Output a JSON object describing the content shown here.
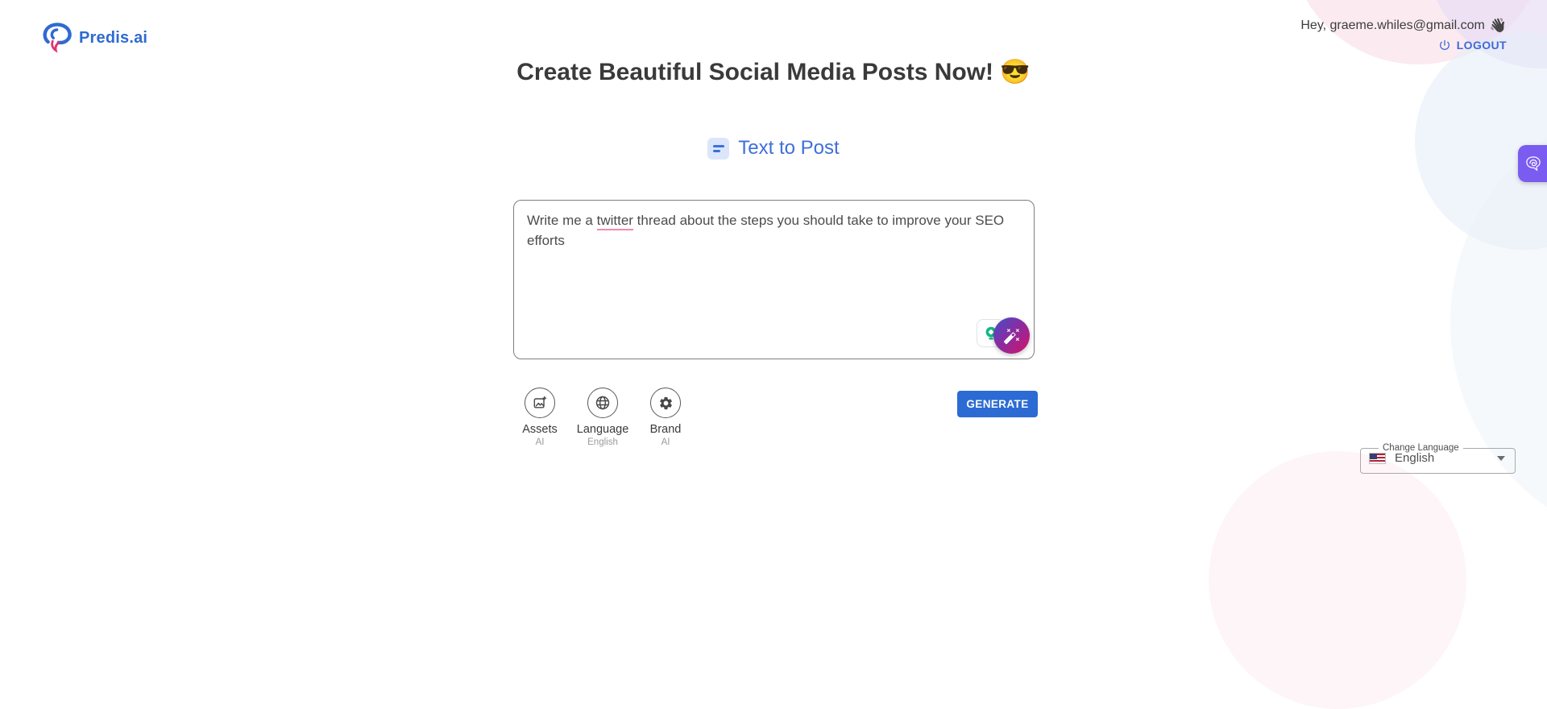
{
  "header": {
    "brand": "Predis.ai",
    "greeting": "Hey, graeme.whiles@gmail.com",
    "greeting_emoji": "👋",
    "logout": "LOGOUT"
  },
  "main": {
    "title": "Create Beautiful Social Media Posts Now!",
    "title_emoji": "😎",
    "tab": "Text to Post",
    "prompt": {
      "value_before": "Write me a ",
      "value_misspelled": "twitter",
      "value_after": " thread about the steps you should take to improve your SEO efforts"
    },
    "options": [
      {
        "label": "Assets",
        "sublabel": "AI",
        "icon": "add-image-icon"
      },
      {
        "label": "Language",
        "sublabel": "English",
        "icon": "globe-icon"
      },
      {
        "label": "Brand",
        "sublabel": "AI",
        "icon": "gear-icon"
      }
    ],
    "generate": "GENERATE"
  },
  "footer": {
    "change_language_label": "Change Language",
    "change_language_value": "English"
  },
  "colors": {
    "accent_blue": "#2c6bd3",
    "link_blue": "#3e6fd9",
    "tab_chip_bg": "#dbe6fb",
    "spellcheck_underline": "#f48bab",
    "wand_gradient_start": "#4150c8",
    "wand_gradient_end": "#d41268",
    "idea_green": "#0fb884",
    "fab_purple": "#7a5cf0",
    "text_dark": "#3a3a3a",
    "text_muted": "#9a9a9a"
  }
}
